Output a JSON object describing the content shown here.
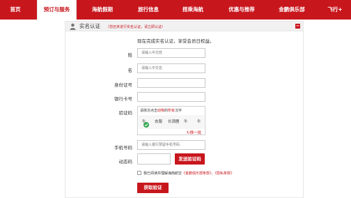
{
  "nav": {
    "items": [
      {
        "label": "首页",
        "active": false
      },
      {
        "label": "预订与服务",
        "active": true
      },
      {
        "label": "海航假期",
        "active": false
      },
      {
        "label": "旅行信息",
        "active": false
      },
      {
        "label": "搭乘海航",
        "active": false
      },
      {
        "label": "优惠与推荐",
        "active": false
      },
      {
        "label": "金鹏俱乐部",
        "active": false
      },
      {
        "label": "飞行+",
        "active": false
      }
    ]
  },
  "panel": {
    "title": "实名认证",
    "tip": "（您还未进行实名认证，请立即认证）",
    "collapse": "−"
  },
  "form": {
    "intro": "现在完成实名认证，享受会员日权益。",
    "surname_label": "姓",
    "surname_placeholder": "请输入中文姓",
    "givenname_label": "名",
    "givenname_placeholder": "请输入中文名",
    "idcard_label": "身份证号",
    "bankcard_label": "银行卡号",
    "captcha_label": "验证码",
    "captcha": {
      "instr_prefix": "请依次点击",
      "instr_highlight_1": "动物",
      "instr_middle": "的",
      "instr_highlight_2": "所有",
      "instr_suffix": "汉字",
      "chars": [
        "牛",
        "衣服",
        "长颈鹿",
        "牛",
        "牛"
      ],
      "refresh": "换一批"
    },
    "phone_label": "手机号码",
    "phone_placeholder": "请输入银行预留手机号码",
    "otp_label": "动态码",
    "send_otp": "发送验证码",
    "agree_prefix": "我已阅读并理解海南航空",
    "agree_link_1": "《金鹏俱乐部条款》",
    "agree_sep": "、",
    "agree_link_2": "《隐私条款》",
    "submit": "获取验证"
  },
  "colors": {
    "brand_red": "#c8161d",
    "success_green": "#34a853"
  }
}
